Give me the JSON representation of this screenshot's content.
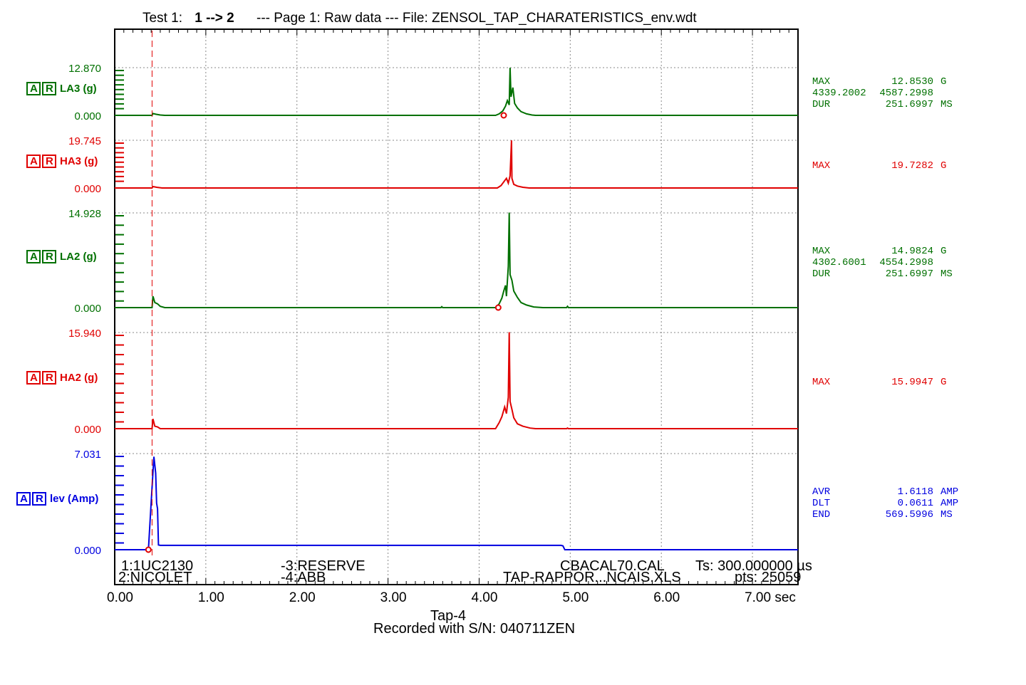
{
  "header": {
    "prefix": "Test 1:",
    "transition": "1 --> 2",
    "rest": "--- Page 1: Raw data --- File: ZENSOL_TAP_CHARATERISTICS_env.wdt"
  },
  "colors": {
    "green": "#007000",
    "red": "#e00000",
    "blue": "#0000e0",
    "grid": "#8a8a8a"
  },
  "chart_data": {
    "type": "line",
    "x_unit": "sec",
    "x_range": [
      0,
      7.5
    ],
    "x_ticks": [
      {
        "value": 0,
        "label": "0.00"
      },
      {
        "value": 1,
        "label": "1.00"
      },
      {
        "value": 2,
        "label": "2.00"
      },
      {
        "value": 3,
        "label": "3.00"
      },
      {
        "value": 4,
        "label": "4.00"
      },
      {
        "value": 5,
        "label": "5.00"
      },
      {
        "value": 6,
        "label": "6.00"
      },
      {
        "value": 7,
        "label": "7.00 sec"
      }
    ],
    "cursor_time": 0.41,
    "series": [
      {
        "name": "LA3 (g)",
        "color": "#007000",
        "ymin": 0,
        "ymax": 12.87,
        "top_label": "12.870",
        "zero_label": "0.000",
        "marker_time": 4.27,
        "points": [
          [
            0,
            0
          ],
          [
            0.41,
            0
          ],
          [
            0.42,
            0.5
          ],
          [
            0.45,
            0.3
          ],
          [
            0.5,
            0.1
          ],
          [
            0.55,
            0
          ],
          [
            4.18,
            0
          ],
          [
            4.22,
            0.4
          ],
          [
            4.26,
            1.2
          ],
          [
            4.29,
            2.5
          ],
          [
            4.31,
            4.0
          ],
          [
            4.33,
            2.8
          ],
          [
            4.34,
            12.853
          ],
          [
            4.35,
            5.0
          ],
          [
            4.37,
            7.5
          ],
          [
            4.39,
            3.2
          ],
          [
            4.42,
            2.0
          ],
          [
            4.46,
            1.0
          ],
          [
            4.52,
            0.4
          ],
          [
            4.58,
            0.1
          ],
          [
            4.62,
            0
          ],
          [
            7.5,
            0
          ]
        ],
        "stats": [
          [
            "MAX",
            "12.8530",
            "G"
          ],
          [
            "4339.2002",
            "4587.2998",
            ""
          ],
          [
            "DUR",
            "251.6997",
            "MS"
          ]
        ]
      },
      {
        "name": "HA3 (g)",
        "color": "#e00000",
        "ymin": 0,
        "ymax": 19.745,
        "top_label": "19.745",
        "zero_label": "0.000",
        "points": [
          [
            0,
            0
          ],
          [
            0.41,
            0
          ],
          [
            0.42,
            0.6
          ],
          [
            0.46,
            0.3
          ],
          [
            0.52,
            0
          ],
          [
            4.2,
            0
          ],
          [
            4.24,
            1.0
          ],
          [
            4.27,
            2.5
          ],
          [
            4.3,
            4.0
          ],
          [
            4.32,
            2.0
          ],
          [
            4.34,
            5.0
          ],
          [
            4.355,
            19.728
          ],
          [
            4.36,
            4.0
          ],
          [
            4.38,
            1.5
          ],
          [
            4.42,
            0.8
          ],
          [
            4.48,
            0.3
          ],
          [
            4.55,
            0
          ],
          [
            7.5,
            0
          ]
        ],
        "stats": [
          [
            "MAX",
            "19.7282",
            "G"
          ]
        ]
      },
      {
        "name": "LA2 (g)",
        "color": "#007000",
        "ymin": 0,
        "ymax": 14.928,
        "top_label": "14.928",
        "zero_label": "0.000",
        "marker_time": 4.21,
        "points": [
          [
            0,
            0
          ],
          [
            0.41,
            0
          ],
          [
            0.42,
            1.8
          ],
          [
            0.44,
            0.8
          ],
          [
            0.47,
            0.6
          ],
          [
            0.5,
            0.2
          ],
          [
            0.55,
            0
          ],
          [
            3.58,
            0
          ],
          [
            3.59,
            0.15
          ],
          [
            3.6,
            0
          ],
          [
            4.18,
            0
          ],
          [
            4.22,
            0.6
          ],
          [
            4.25,
            1.5
          ],
          [
            4.27,
            2.6
          ],
          [
            4.29,
            3.5
          ],
          [
            4.3,
            1.8
          ],
          [
            4.32,
            6.5
          ],
          [
            4.33,
            14.982
          ],
          [
            4.34,
            5.2
          ],
          [
            4.36,
            4.3
          ],
          [
            4.38,
            2.6
          ],
          [
            4.42,
            1.6
          ],
          [
            4.46,
            0.8
          ],
          [
            4.52,
            0.4
          ],
          [
            4.6,
            0.1
          ],
          [
            4.7,
            0
          ],
          [
            4.96,
            0
          ],
          [
            4.97,
            0.2
          ],
          [
            4.98,
            0
          ],
          [
            7.5,
            0
          ]
        ],
        "stats": [
          [
            "MAX",
            "14.9824",
            "G"
          ],
          [
            "4302.6001",
            "4554.2998",
            ""
          ],
          [
            "DUR",
            "251.6997",
            "MS"
          ]
        ]
      },
      {
        "name": "HA2 (g)",
        "color": "#e00000",
        "ymin": 0,
        "ymax": 15.94,
        "top_label": "15.940",
        "zero_label": "0.000",
        "points": [
          [
            0,
            0
          ],
          [
            0.41,
            0
          ],
          [
            0.42,
            1.6
          ],
          [
            0.44,
            0.4
          ],
          [
            0.47,
            0.3
          ],
          [
            0.5,
            0
          ],
          [
            4.18,
            0
          ],
          [
            4.22,
            1.0
          ],
          [
            4.25,
            2.0
          ],
          [
            4.28,
            3.6
          ],
          [
            4.3,
            2.5
          ],
          [
            4.32,
            5.2
          ],
          [
            4.33,
            15.995
          ],
          [
            4.34,
            4.5
          ],
          [
            4.36,
            3.2
          ],
          [
            4.38,
            1.8
          ],
          [
            4.42,
            0.8
          ],
          [
            4.48,
            0.4
          ],
          [
            4.56,
            0.1
          ],
          [
            4.62,
            0
          ],
          [
            4.96,
            0
          ],
          [
            4.97,
            0.1
          ],
          [
            4.98,
            0
          ],
          [
            7.5,
            0
          ]
        ],
        "stats": [
          [
            "MAX",
            "15.9947",
            "G"
          ]
        ]
      },
      {
        "name": "lev (Amp)",
        "color": "#0000e0",
        "ymin": 0,
        "ymax": 7.031,
        "top_label": "7.031",
        "zero_label": "0.000",
        "marker_time": 0.37,
        "points": [
          [
            0,
            0
          ],
          [
            0.37,
            0
          ],
          [
            0.4,
            3.4
          ],
          [
            0.43,
            6.8
          ],
          [
            0.45,
            5.6
          ],
          [
            0.46,
            3.4
          ],
          [
            0.47,
            3.0
          ],
          [
            0.48,
            0.35
          ],
          [
            0.5,
            0.32
          ],
          [
            4.9,
            0.32
          ],
          [
            4.92,
            0.28
          ],
          [
            4.94,
            0
          ],
          [
            7.5,
            0
          ]
        ],
        "stats": [
          [
            "AVR",
            "1.6118",
            "AMP"
          ],
          [
            "DLT",
            "0.0611",
            "AMP"
          ],
          [
            "END",
            "569.5996",
            "MS"
          ]
        ]
      }
    ]
  },
  "footer_info": {
    "channel_1": "1:1UC2130",
    "channel_2": "2:NICOLET",
    "channel_3": "-3:RESERVE",
    "channel_4": "-4:ABB",
    "cal_file": "CBACAL70.CAL",
    "ts": "Ts: 300.000000 µs",
    "report": "TAP-RAPPOR...NCAIS.XLS",
    "pts": "pts: 25059"
  },
  "bottom": {
    "tap": "Tap-4",
    "recorded": "Recorded with  S/N: 040711ZEN"
  }
}
